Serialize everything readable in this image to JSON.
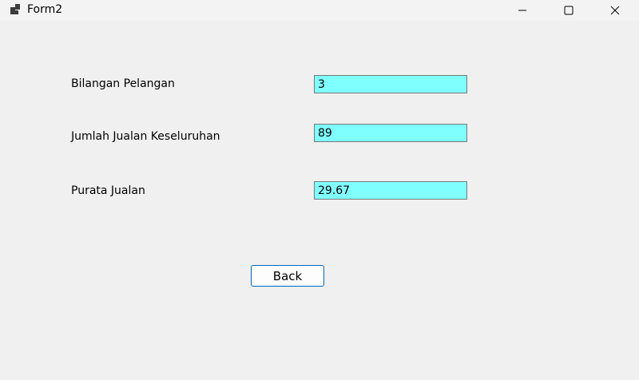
{
  "window": {
    "title": "Form2"
  },
  "titlebar": {
    "app_icon": "form-app-icon",
    "minimize_icon": "minimize-icon",
    "maximize_icon": "maximize-icon",
    "close_icon": "close-icon"
  },
  "form": {
    "fields": [
      {
        "label": "Bilangan Pelangan",
        "value": "3"
      },
      {
        "label": "Jumlah Jualan Keseluruhan",
        "value": "89"
      },
      {
        "label": "Purata Jualan",
        "value": "29.67"
      }
    ],
    "back_label": "Back",
    "field_color": "#80ffff",
    "button_border_color": "#0067c0"
  }
}
